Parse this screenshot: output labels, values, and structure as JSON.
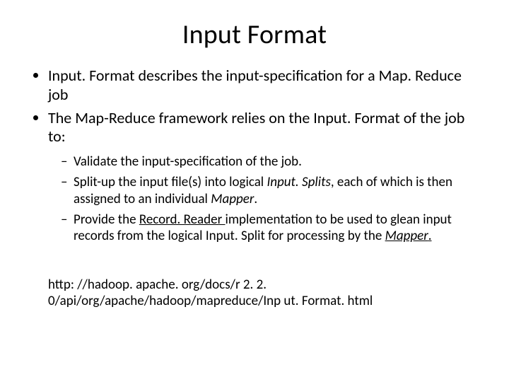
{
  "title": "Input Format",
  "bullets": {
    "b1_pre": "Input. Format describes the input-specification for a Map. Reduce job",
    "b2_pre": "The Map-Reduce framework relies on the Input. Format of the job to:",
    "sub1": "Validate the input-specification of the job.",
    "sub2_a": "Split-up the input file(s) into logical ",
    "sub2_b": "Input. Splits",
    "sub2_c": ", each of which is then assigned to an individual ",
    "sub2_d": "Mapper",
    "sub2_e": ".",
    "sub3_a": "Provide the ",
    "sub3_b": "Record. Reader ",
    "sub3_c": "implementation to be used to glean input records from the logical Input. Split for processing by the ",
    "sub3_d": "Mapper",
    "sub3_e": "."
  },
  "footer": "http: //hadoop. apache. org/docs/r 2. 2. 0/api/org/apache/hadoop/mapreduce/Inp ut. Format. html"
}
